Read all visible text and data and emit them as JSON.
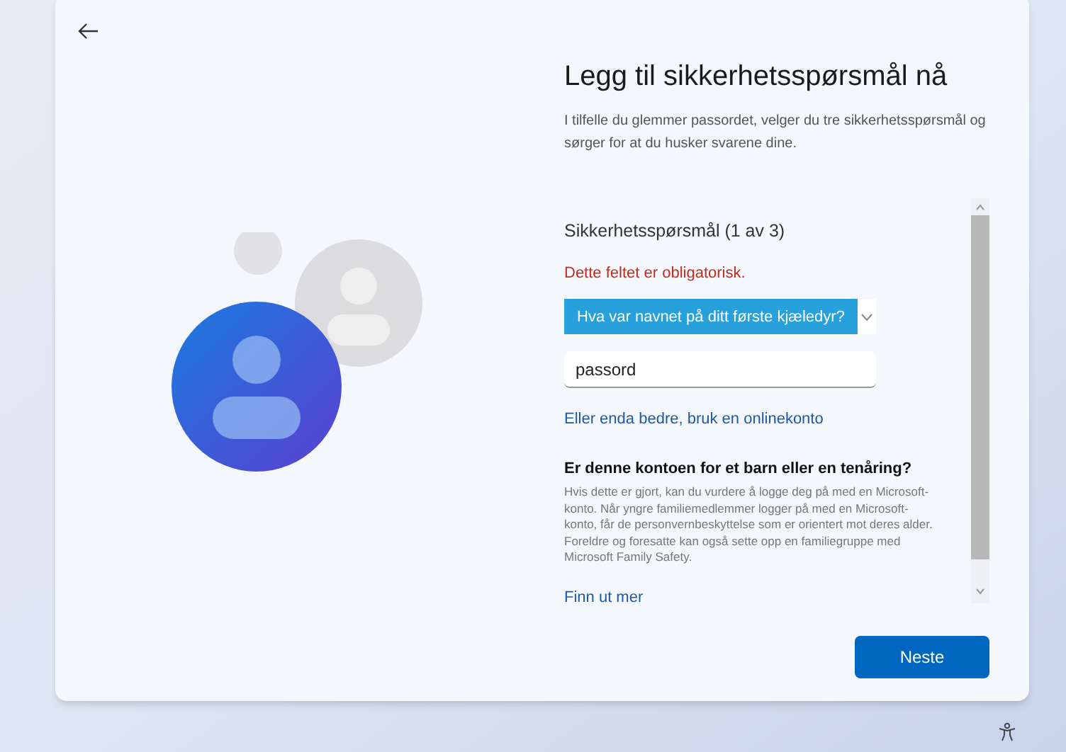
{
  "title": "Legg til sikkerhetsspørsmål nå",
  "description": "I tilfelle du glemmer passordet, velger du tre sikkerhetsspørsmål og sørger for at du husker svarene dine.",
  "question_heading": "Sikkerhetsspørsmål (1 av 3)",
  "error": "Dette feltet er obligatorisk.",
  "question_dropdown": {
    "value": "Hva var navnet på ditt første kjæledyr?",
    "expanded": false
  },
  "answer_field": {
    "value": "passord"
  },
  "online_account_link": "Eller enda bedre, bruk en onlinekonto",
  "child_heading": "Er denne kontoen for et barn eller en tenåring?",
  "child_text": "Hvis dette er gjort, kan du vurdere å logge deg på med en Microsoft-konto. Når yngre familiemedlemmer logger på med en Microsoft-konto, får de personvernbeskyttelse som er orientert mot deres alder. Foreldre og foresatte kan også sette opp en familiegruppe med Microsoft Family Safety.",
  "learn_more_link": "Finn ut mer",
  "next_button": "Neste"
}
